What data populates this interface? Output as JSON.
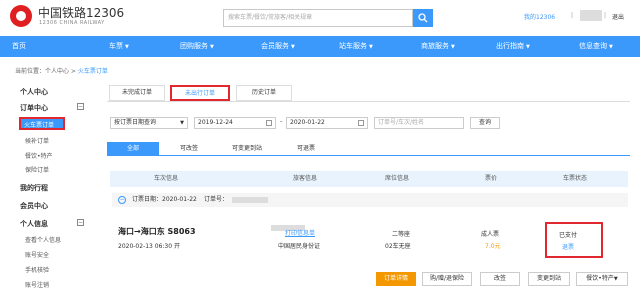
{
  "header": {
    "logo_title": "中国铁路12306",
    "logo_subtitle": "12306 CHINA RAILWAY",
    "search_placeholder": "搜索车票/餐饮/常旅客/相关规章",
    "user_label": "我的12306",
    "logout": "退出"
  },
  "nav": [
    {
      "label": "首页",
      "has_caret": false
    },
    {
      "label": "车票",
      "has_caret": true
    },
    {
      "label": "团购服务",
      "has_caret": true
    },
    {
      "label": "会员服务",
      "has_caret": true
    },
    {
      "label": "站车服务",
      "has_caret": true
    },
    {
      "label": "商旅服务",
      "has_caret": true
    },
    {
      "label": "出行指南",
      "has_caret": true
    },
    {
      "label": "信息查询",
      "has_caret": true
    }
  ],
  "breadcrumb": {
    "prefix": "当前位置：个人中心 > ",
    "current": "火车票订单"
  },
  "sidebar": {
    "personal_center": "个人中心",
    "order_center": "订单中心",
    "train_orders": "火车票订单",
    "makeup_orders": "候补订单",
    "catering_orders": "餐饮•特产",
    "insurance_orders": "保险订单",
    "my_trips": "我的行程",
    "member_center": "会员中心",
    "personal_info": "个人信息",
    "view_info": "查看个人信息",
    "account_security": "账号安全",
    "phone_verify": "手机核验",
    "account_logout": "账号注销"
  },
  "tabs": [
    "未完成订单",
    "未出行订单",
    "历史订单"
  ],
  "filters": {
    "date_type": "按订票日期查询",
    "start_date": "2019-12-24",
    "end_date": "2020-01-22",
    "keyword_placeholder": "订单号/车次/姓名",
    "query": "查询"
  },
  "status_tabs": [
    "全部",
    "可改签",
    "可变更到站",
    "可退票"
  ],
  "table_headers": [
    "车次信息",
    "旅客信息",
    "席位信息",
    "票价",
    "车票状态"
  ],
  "order": {
    "date_label": "订票日期：2020-01-22",
    "order_no_label": "订单号：",
    "route": "海口→海口东  S8063",
    "departure": "2020-02-13    06:30 开",
    "print_link": "打印信息单",
    "id_type": "中国居民身份证",
    "seat_class": "二等座",
    "seat_no": "02车无座",
    "ticket_type": "成人票",
    "price": "7.0元",
    "status": "已支付",
    "refund": "退票"
  },
  "actions": [
    "订单详情",
    "购/赠/退保险",
    "改签",
    "变更到站",
    "餐饮•特产"
  ],
  "colors": {
    "accent": "#3b99fc",
    "highlight": "#e0282e",
    "orange": "#f39800"
  }
}
